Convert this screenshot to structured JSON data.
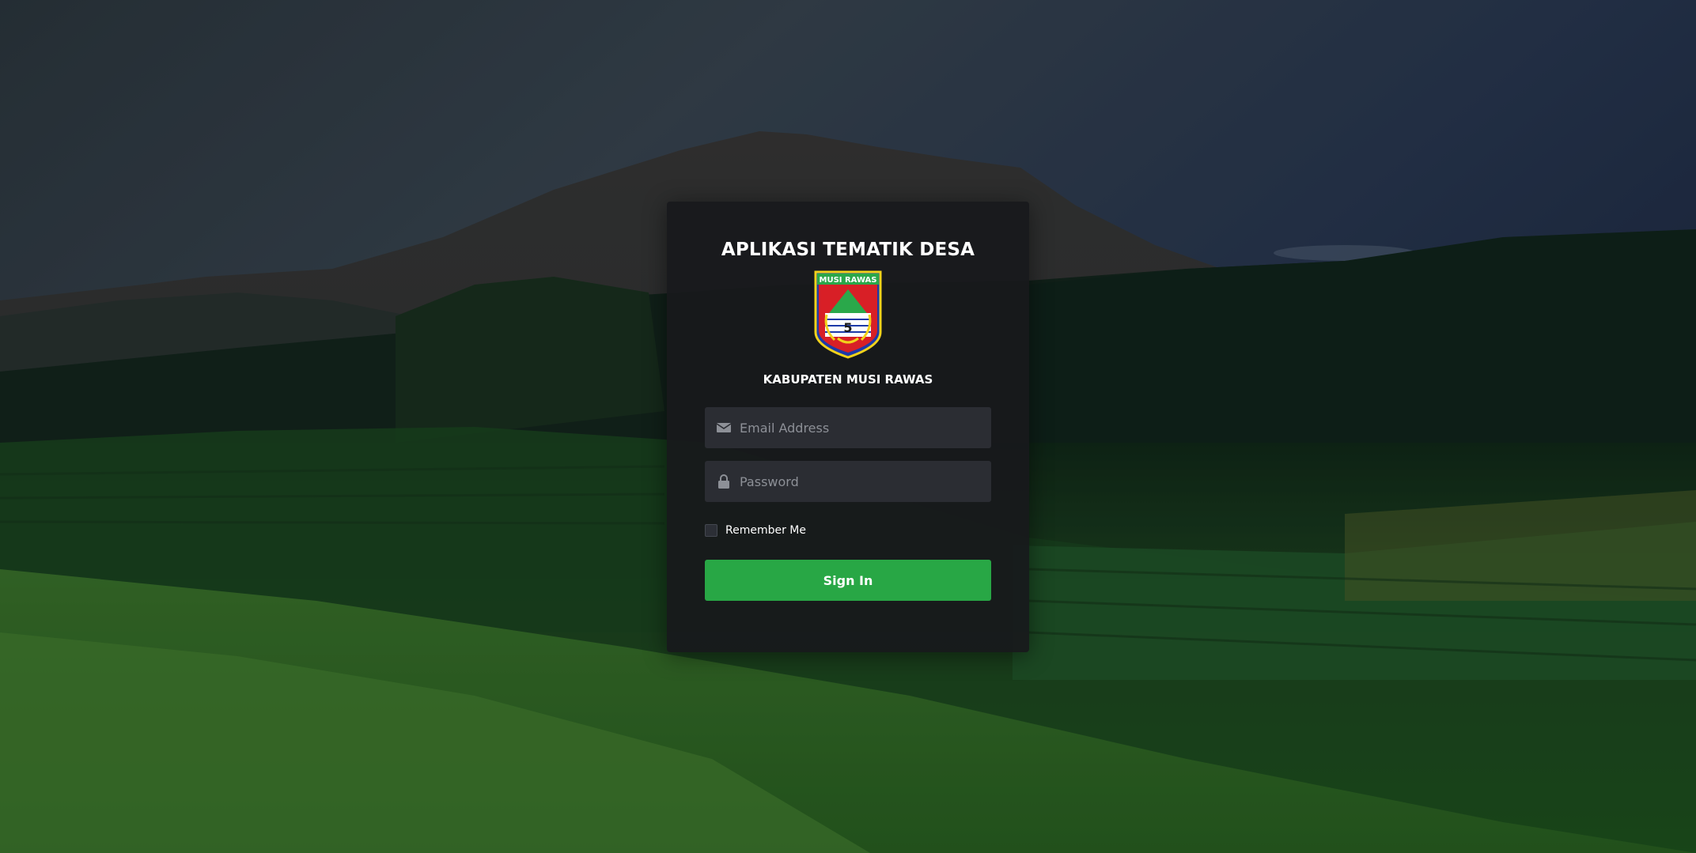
{
  "app": {
    "title": "APLIKASI TEMATIK DESA",
    "subtitle": "KABUPATEN MUSI RAWAS",
    "logo_text": "MUSI RAWAS"
  },
  "form": {
    "email_placeholder": "Email Address",
    "email_value": "",
    "email_icon": "envelope-icon",
    "password_placeholder": "Password",
    "password_value": "",
    "password_icon": "lock-icon",
    "remember_label": "Remember Me",
    "remember_checked": false,
    "signin_label": "Sign In"
  },
  "colors": {
    "card_bg": "#18191c",
    "input_bg": "#2b2d33",
    "accent": "#28a745",
    "text": "#ffffff",
    "placeholder": "#8d9097"
  }
}
